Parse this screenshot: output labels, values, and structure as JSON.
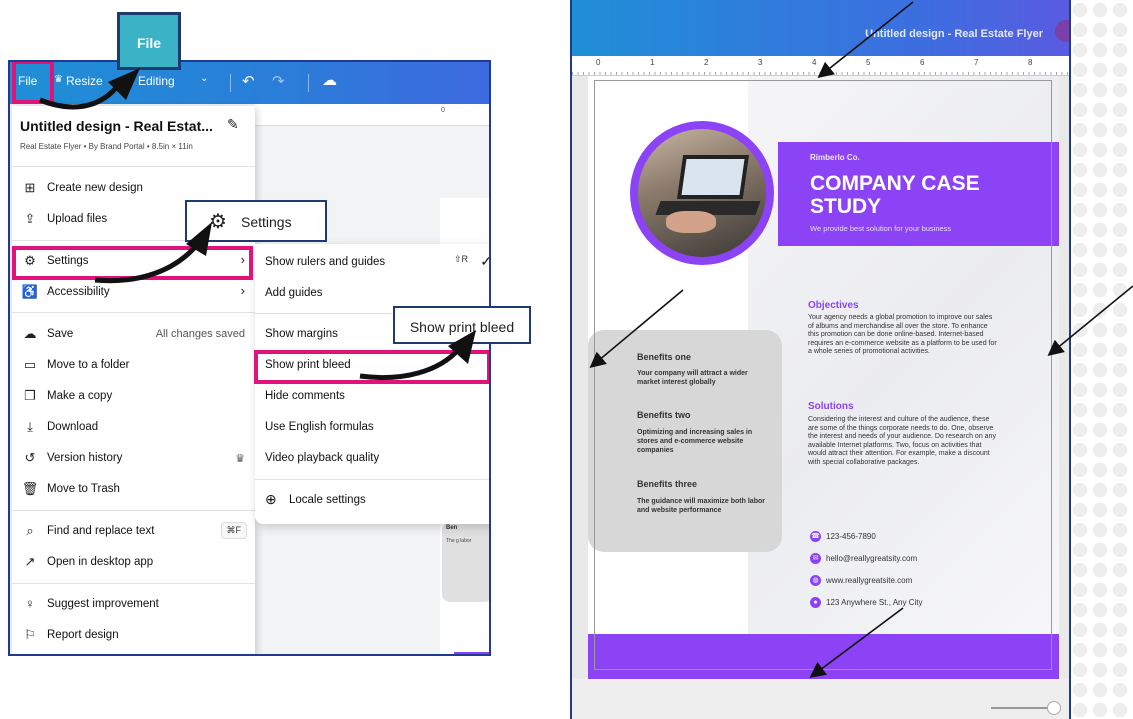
{
  "left": {
    "toolbar": {
      "file": "File",
      "resize": "Resize",
      "editing": "Editing"
    },
    "background_canvas": {
      "ruler_zero": "0",
      "card_title": "Ben",
      "card_text": "The g labor"
    },
    "file_menu": {
      "title": "Untitled design - Real Estat...",
      "subtitle": "Real Estate Flyer • By Brand Portal • 8.5in × 11in",
      "items": [
        {
          "icon": "create-plus-icon",
          "label": "Create new design"
        },
        {
          "icon": "upload-icon",
          "label": "Upload files"
        },
        {
          "icon": "gear-icon",
          "label": "Settings"
        },
        {
          "icon": "accessibility-icon",
          "label": "Accessibility"
        },
        {
          "icon": "cloud-check-icon",
          "label": "Save",
          "right": "All changes saved"
        },
        {
          "icon": "folder-icon",
          "label": "Move to a folder"
        },
        {
          "icon": "copy-icon",
          "label": "Make a copy"
        },
        {
          "icon": "download-icon",
          "label": "Download"
        },
        {
          "icon": "history-icon",
          "label": "Version history"
        },
        {
          "icon": "trash-icon",
          "label": "Move to Trash"
        },
        {
          "icon": "search-icon",
          "label": "Find and replace text",
          "shortcut": "⌘F"
        },
        {
          "icon": "external-link-icon",
          "label": "Open in desktop app"
        },
        {
          "icon": "lightbulb-icon",
          "label": "Suggest improvement"
        },
        {
          "icon": "flag-icon",
          "label": "Report design"
        }
      ]
    },
    "settings_menu": {
      "items": [
        {
          "label": "Show rulers and guides",
          "shortcut": "⇧R"
        },
        {
          "label": "Add guides"
        },
        {
          "label": "Show margins"
        },
        {
          "label": "Show print bleed"
        },
        {
          "label": "Hide comments"
        },
        {
          "label": "Use English formulas"
        },
        {
          "label": "Video playback quality"
        },
        {
          "label": "Locale settings",
          "icon": "globe-icon"
        }
      ]
    },
    "callouts": {
      "file": "File",
      "settings": "Settings",
      "print_bleed": "Show print bleed"
    },
    "highlight_color": "#e0137a"
  },
  "right": {
    "title": "Untitled design - Real Estate Flyer",
    "ruler_labels": [
      "0",
      "1",
      "2",
      "3",
      "4",
      "5",
      "6",
      "7",
      "8"
    ],
    "flyer": {
      "company_small": "Rimberlo Co.",
      "headline": "COMPANY CASE STUDY",
      "tagline": "We provide best solution for your business",
      "benefits": [
        {
          "title": "Benefits one",
          "text": "Your company will attract a wider market interest globally"
        },
        {
          "title": "Benefits two",
          "text": "Optimizing and increasing sales in stores and e-commerce website companies"
        },
        {
          "title": "Benefits three",
          "text": "The guidance will maximize both labor and website performance"
        }
      ],
      "objectives_title": "Objectives",
      "objectives_text": "Your agency needs a global promotion to improve our sales of albums and merchandise all over the store. To enhance this promotion can be done online-based. Internet-based requires an e-commerce website as a platform to be used for a whole series of promotional activities.",
      "solutions_title": "Solutions",
      "solutions_text": "Considering the interest and culture of the audience, these are some of the things corporate needs to do. One, observe the interest and needs of your audience. Do research on any available Internet platforms. Two, focus on activities that would attract their attention. For example, make a discount with special collaborative packages.",
      "contacts": [
        {
          "icon": "phone-icon",
          "text": "123-456-7890"
        },
        {
          "icon": "email-icon",
          "text": "hello@reallygreatsity.com"
        },
        {
          "icon": "web-icon",
          "text": "www.reallygreatsite.com"
        },
        {
          "icon": "location-icon",
          "text": "123 Anywhere St., Any City"
        }
      ],
      "accent_color": "#8b43f5"
    }
  }
}
